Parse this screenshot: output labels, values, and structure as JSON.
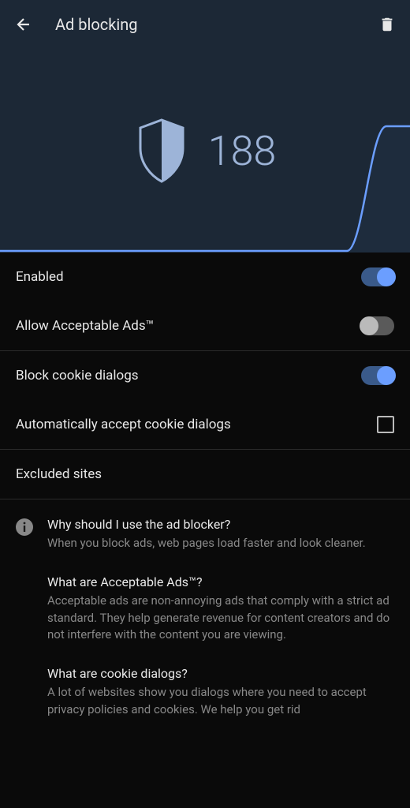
{
  "header": {
    "title": "Ad blocking"
  },
  "hero": {
    "count": "188"
  },
  "settings": {
    "enabled": {
      "label": "Enabled",
      "state": "on"
    },
    "acceptable_ads": {
      "label": "Allow Acceptable Ads™",
      "state": "off"
    },
    "block_cookie": {
      "label": "Block cookie dialogs",
      "state": "on"
    },
    "auto_accept": {
      "label": "Automatically accept cookie dialogs",
      "checked": false
    },
    "excluded": {
      "label": "Excluded sites"
    }
  },
  "info": {
    "blocks": [
      {
        "question": "Why should I use the ad blocker?",
        "answer": "When you block ads, web pages load faster and look cleaner."
      },
      {
        "question": "What are Acceptable Ads™?",
        "answer": "Acceptable ads are non-annoying ads that comply with a strict ad standard. They help generate revenue for content creators and do not interfere with the content you are viewing."
      },
      {
        "question": "What are cookie dialogs?",
        "answer": "A lot of websites show you dialogs where you need to accept privacy policies and cookies. We help you get rid"
      }
    ]
  },
  "colors": {
    "hero_bg": "#1c2836",
    "accent": "#6b9eff",
    "text_primary": "#e8e8e8",
    "text_secondary": "#888"
  }
}
